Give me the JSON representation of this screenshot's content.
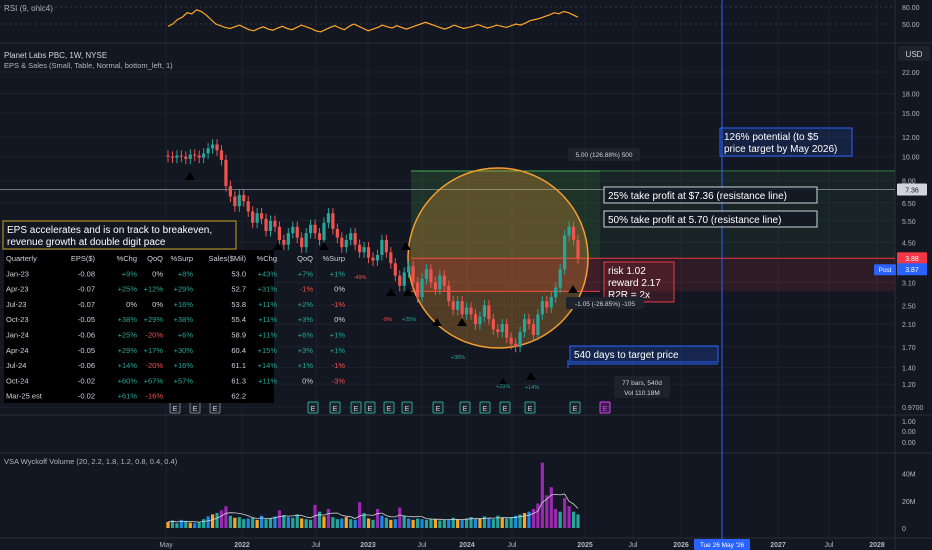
{
  "rsi_panel": {
    "title": "RSI (9, ohlc4)",
    "ticks": [
      "80.00",
      "50.00"
    ],
    "values": [
      46,
      50,
      58,
      62,
      70,
      68,
      75,
      72,
      66,
      58,
      50,
      47,
      44,
      42,
      45,
      48,
      44,
      40,
      38,
      42,
      45,
      41,
      39,
      43,
      46,
      42,
      40,
      44,
      48,
      45,
      42,
      38,
      36,
      40,
      44,
      47,
      43,
      40,
      46,
      50,
      46,
      42,
      38,
      41,
      44,
      48,
      45,
      43,
      47,
      44,
      41,
      44,
      47,
      50,
      53,
      50,
      47,
      44,
      41,
      44,
      48,
      45,
      42,
      44,
      46,
      49,
      46,
      43,
      45,
      48,
      46,
      44,
      47,
      50,
      48,
      52,
      56,
      58,
      60,
      63,
      66,
      70,
      68,
      72,
      70,
      66,
      62
    ]
  },
  "header": {
    "symbol_line": "Planet Labs PBC, 1W, NYSE",
    "indicator_line": "EPS & Sales (Small, Table, Normal, bottom_left, 1)",
    "currency": "USD"
  },
  "price_axis": {
    "ticks": [
      "22.00",
      "18.00",
      "15.00",
      "12.00",
      "10.00",
      "8.00",
      "6.50",
      "5.50",
      "4.50",
      "3.10",
      "2.50",
      "2.10",
      "1.70",
      "1.40",
      "1.20",
      "0.9700",
      "0.00"
    ],
    "current_price": "7.36",
    "red_tag": "3.88",
    "post_label": "Post",
    "post_price": "3.87"
  },
  "chart_data": {
    "type": "candlestick",
    "interval": "1W",
    "scale": "log",
    "ylim": [
      0.97,
      22.0
    ],
    "x_ticks": [
      "May",
      "2022",
      "Jul",
      "2023",
      "Jul",
      "2024",
      "Jul",
      "2025",
      "Jul",
      "2026",
      "Tue 26 May '26",
      "2027",
      "Jul",
      "2028"
    ],
    "close": [
      10.0,
      9.9,
      10.1,
      10.0,
      9.8,
      10.2,
      10.1,
      9.9,
      10.3,
      10.8,
      11.2,
      10.6,
      9.7,
      7.6,
      6.9,
      6.3,
      7.0,
      6.6,
      6.0,
      5.4,
      5.9,
      5.6,
      5.0,
      5.5,
      5.2,
      4.6,
      4.4,
      4.9,
      5.2,
      4.7,
      4.3,
      4.9,
      5.3,
      4.9,
      4.6,
      5.4,
      5.9,
      5.1,
      4.7,
      4.3,
      4.6,
      4.9,
      4.4,
      4.1,
      4.3,
      3.9,
      3.8,
      4.0,
      4.6,
      4.1,
      3.7,
      3.3,
      3.0,
      3.4,
      3.6,
      3.1,
      2.7,
      3.2,
      3.5,
      3.1,
      2.9,
      3.3,
      3.0,
      2.6,
      2.4,
      2.6,
      2.3,
      2.45,
      2.3,
      2.1,
      2.25,
      2.5,
      2.2,
      2.0,
      1.95,
      2.1,
      1.85,
      1.75,
      1.7,
      1.95,
      2.2,
      2.1,
      1.9,
      2.3,
      2.6,
      2.45,
      2.7,
      2.95,
      3.5,
      4.8,
      5.2,
      4.6,
      3.88
    ],
    "volume_bars": [
      4.5,
      5.5,
      3.5,
      6.0,
      5.0,
      4.0,
      3.5,
      4.0,
      6.5,
      8.5,
      10.0,
      11.0,
      13.0,
      16.0,
      9.0,
      7.5,
      8.0,
      6.5,
      7.0,
      7.5,
      6.0,
      9.0,
      6.5,
      7.0,
      8.5,
      13.0,
      9.5,
      8.0,
      7.5,
      10.0,
      7.0,
      6.5,
      6.0,
      17.0,
      12.0,
      8.5,
      14.0,
      8.0,
      6.5,
      7.0,
      8.0,
      6.5,
      6.0,
      19.0,
      11.0,
      7.0,
      6.0,
      14.0,
      9.0,
      7.5,
      6.0,
      6.5,
      15.0,
      9.0,
      7.0,
      6.0,
      7.0,
      6.5,
      6.0,
      7.0,
      6.5,
      5.5,
      6.0,
      6.0,
      7.5,
      6.5,
      6.0,
      7.0,
      8.0,
      6.5,
      7.0,
      8.5,
      7.0,
      6.5,
      9.0,
      7.5,
      7.0,
      8.0,
      9.0,
      10.0,
      11.0,
      12.0,
      14.0,
      18.0,
      48.0,
      24.0,
      30.0,
      14.0,
      12.0,
      22.0,
      16.0,
      12.0,
      10.0
    ],
    "annotations": {
      "potential": [
        "126% potential (to $5",
        "price target by May 2026)"
      ],
      "take_profit_1": "25% take profit at $7.36 (resistance line)",
      "take_profit_2": "50% take profit at 5.70 (resistance line)",
      "eps_note": [
        "EPS accelerates and is on track to breakeven,",
        "revenue growth at double digit pace"
      ],
      "risk_box": [
        "risk 1.02",
        "reward 2.17",
        "R2R = 2x"
      ],
      "days_to_target": "540 days to target price",
      "target_label": "5.00 (126.88%) 500",
      "stop_label": "-1.05 (-26.85%) -105",
      "bars_label": [
        "77 bars, 540d",
        "Vol 110.18M"
      ],
      "marker_pcts": [
        "-49%",
        "-9%",
        "+25%",
        "+38%",
        "+29%",
        "+14%"
      ]
    },
    "eps_sales_table": {
      "columns": [
        "Quarterly",
        "EPS($)",
        "%Chg",
        "QoQ",
        "%Surp",
        "Sales($Mil)",
        "%Chg",
        "QoQ",
        "%Surp"
      ],
      "rows": [
        [
          "Jan-23",
          "-0.08",
          "+9%",
          "0%",
          "+8%",
          "53.0",
          "+43%",
          "+7%",
          "+1%"
        ],
        [
          "Apr-23",
          "-0.07",
          "+25%",
          "+12%",
          "+29%",
          "52.7",
          "+31%",
          "-1%",
          "0%"
        ],
        [
          "Jul-23",
          "-0.07",
          "0%",
          "0%",
          "+16%",
          "53.8",
          "+11%",
          "+2%",
          "-1%"
        ],
        [
          "Oct-23",
          "-0.05",
          "+38%",
          "+29%",
          "+38%",
          "55.4",
          "+11%",
          "+3%",
          "0%"
        ],
        [
          "Jan-24",
          "-0.06",
          "+25%",
          "-20%",
          "+6%",
          "58.9",
          "+11%",
          "+6%",
          "+1%"
        ],
        [
          "Apr-24",
          "-0.05",
          "+29%",
          "+17%",
          "+30%",
          "60.4",
          "+15%",
          "+3%",
          "+1%"
        ],
        [
          "Jul-24",
          "-0.06",
          "+14%",
          "-20%",
          "+16%",
          "61.1",
          "+14%",
          "+1%",
          "-1%"
        ],
        [
          "Oct-24",
          "-0.02",
          "+60%",
          "+67%",
          "+57%",
          "61.3",
          "+11%",
          "0%",
          "-3%"
        ],
        [
          "Mar-25 est",
          "-0.02",
          "+61%",
          "-16%",
          "",
          "62.2",
          "",
          "",
          ""
        ]
      ]
    }
  },
  "volume_panel": {
    "title": "VSA Wyckoff Volume (20, 2.2, 1.8, 1.2, 0.8, 0.4, 0.4)",
    "ticks": [
      "40M",
      "20M",
      "0"
    ]
  },
  "colors": {
    "bg": "#131722",
    "up": "#26a69a",
    "down": "#ef5350",
    "accent": "#2962ff",
    "rsi": "#ffa726",
    "circle": "#f59f2f",
    "target_zone": "#4caf50",
    "stop_zone": "#f23645",
    "volume_up": "#9c27b0",
    "volume_mid": "#26a69a"
  }
}
